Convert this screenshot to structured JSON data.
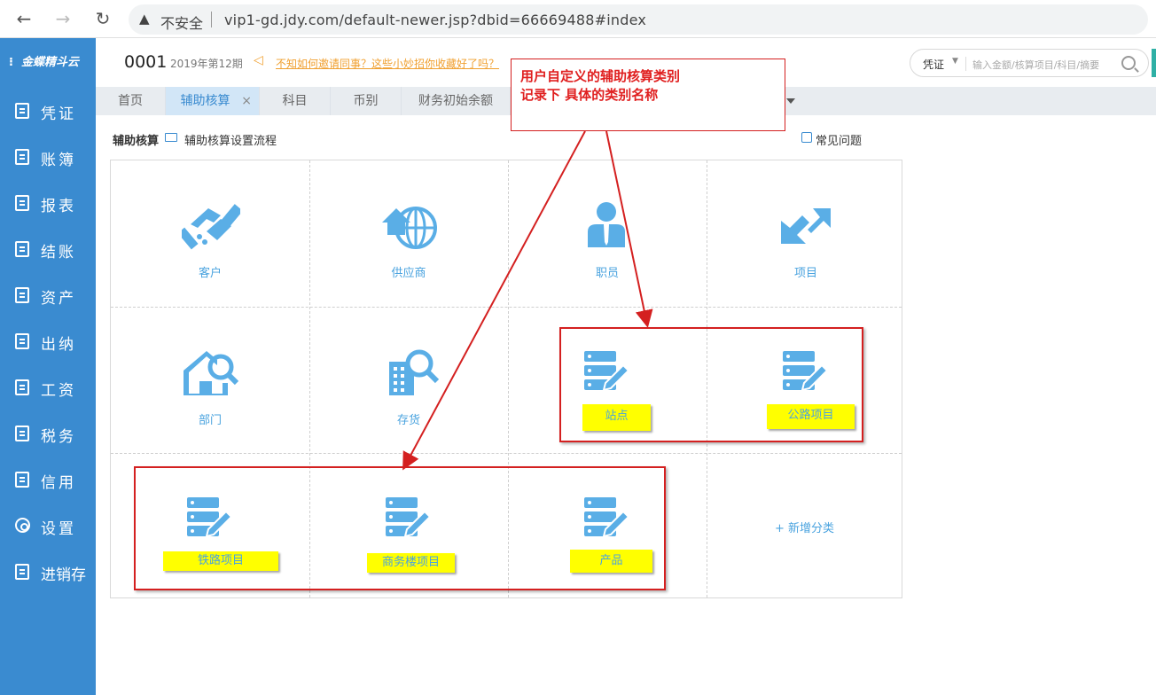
{
  "browser": {
    "back_icon": "arrow-left-icon",
    "insecure_label": "不安全",
    "url": "vip1-gd.jdy.com/default-newer.jsp?dbid=66669488#index"
  },
  "sidebar": {
    "logo": "金蝶精斗云",
    "items": [
      {
        "label": "凭证",
        "icon": "voucher-icon"
      },
      {
        "label": "账簿",
        "icon": "ledger-icon"
      },
      {
        "label": "报表",
        "icon": "report-icon"
      },
      {
        "label": "结账",
        "icon": "closing-icon"
      },
      {
        "label": "资产",
        "icon": "asset-icon"
      },
      {
        "label": "出纳",
        "icon": "cashier-icon"
      },
      {
        "label": "工资",
        "icon": "payroll-icon"
      },
      {
        "label": "税务",
        "icon": "tax-icon"
      },
      {
        "label": "信用",
        "icon": "credit-icon"
      },
      {
        "label": "设置",
        "icon": "gear-icon"
      },
      {
        "label": "进销存",
        "icon": "inventory-icon"
      }
    ]
  },
  "header": {
    "account": "0001",
    "period": "2019年第12期",
    "notice": "不知如何邀请同事？这些小妙招你收藏好了吗？",
    "search_type": "凭证",
    "search_placeholder": "输入金额/核算项目/科目/摘要"
  },
  "tabs": [
    {
      "label": "首页"
    },
    {
      "label": "辅助核算",
      "active": true
    },
    {
      "label": "科目"
    },
    {
      "label": "币别"
    },
    {
      "label": "财务初始余额"
    }
  ],
  "main": {
    "breadcrumb": "辅助核算",
    "flow_link": "辅助核算设置流程",
    "faq": "常见问题",
    "categories": [
      {
        "label": "客户",
        "icon": "handshake-icon"
      },
      {
        "label": "供应商",
        "icon": "globe-house-icon"
      },
      {
        "label": "职员",
        "icon": "employee-icon"
      },
      {
        "label": "项目",
        "icon": "project-arrows-icon"
      },
      {
        "label": "部门",
        "icon": "department-search-icon"
      },
      {
        "label": "存货",
        "icon": "inventory-search-icon"
      },
      {
        "label": "站点",
        "icon": "custom-category-icon"
      },
      {
        "label": "公路项目",
        "icon": "custom-category-icon"
      },
      {
        "label": "铁路项目",
        "icon": "custom-category-icon"
      },
      {
        "label": "商务楼项目",
        "icon": "custom-category-icon"
      },
      {
        "label": "产品",
        "icon": "custom-category-icon"
      }
    ],
    "add_category": "+ 新增分类"
  },
  "annotation": {
    "line1": "用户自定义的辅助核算类别",
    "line2": "记录下  具体的类别名称"
  },
  "colors": {
    "sidebar": "#3a8bd0",
    "icon_blue": "#5aaee6",
    "highlight": "#ffff00",
    "annotation_red": "#d42020"
  }
}
